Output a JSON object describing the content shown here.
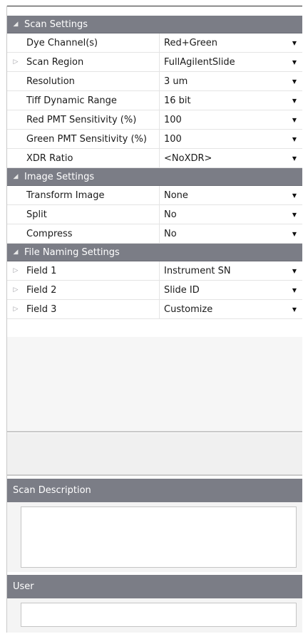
{
  "sections": [
    {
      "title": "Scan Settings",
      "rows": [
        {
          "name": "Dye Channel(s)",
          "value": "Red+Green",
          "expandable": false
        },
        {
          "name": "Scan Region",
          "value": "FullAgilentSlide",
          "expandable": true
        },
        {
          "name": "Resolution",
          "value": "3 um",
          "expandable": false
        },
        {
          "name": "Tiff Dynamic Range",
          "value": "16 bit",
          "expandable": false
        },
        {
          "name": "Red PMT Sensitivity (%)",
          "value": "100",
          "expandable": false
        },
        {
          "name": "Green  PMT Sensitivity (%)",
          "value": "100",
          "expandable": false
        },
        {
          "name": "XDR Ratio",
          "value": "<NoXDR>",
          "expandable": false
        }
      ]
    },
    {
      "title": "Image Settings",
      "rows": [
        {
          "name": "Transform Image",
          "value": "None",
          "expandable": false
        },
        {
          "name": "Split",
          "value": "No",
          "expandable": false
        },
        {
          "name": "Compress",
          "value": "No",
          "expandable": false
        }
      ]
    },
    {
      "title": "File Naming Settings",
      "rows": [
        {
          "name": "Field 1",
          "value": "Instrument SN",
          "expandable": true
        },
        {
          "name": "Field 2",
          "value": "Slide ID",
          "expandable": true
        },
        {
          "name": "Field 3",
          "value": "Customize",
          "expandable": true
        }
      ]
    }
  ],
  "scan_description": {
    "label": "Scan Description",
    "value": ""
  },
  "user": {
    "label": "User",
    "value": ""
  },
  "icons": {
    "collapse": "collapse-triangle-icon",
    "expand": "expand-triangle-icon",
    "dropdown": "dropdown-arrow-icon"
  }
}
